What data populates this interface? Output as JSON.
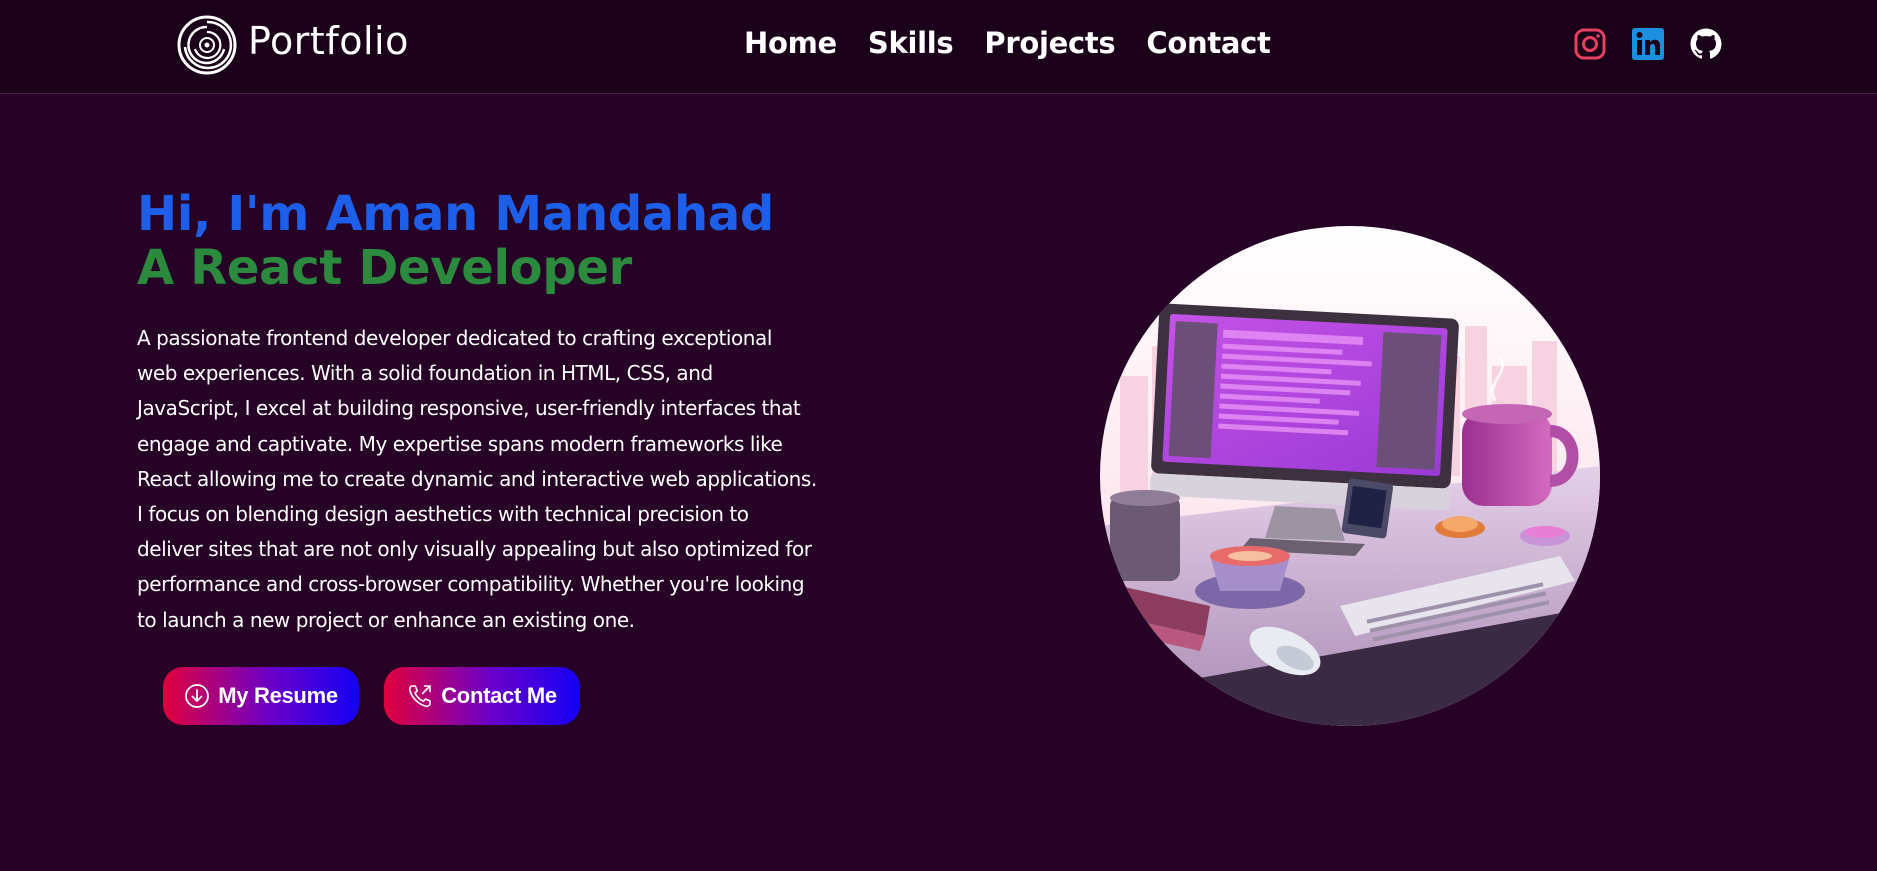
{
  "brand": {
    "name": "Portfolio",
    "logo_icon": "spiral-logo-icon"
  },
  "nav": {
    "links": [
      {
        "label": "Home"
      },
      {
        "label": "Skills"
      },
      {
        "label": "Projects"
      },
      {
        "label": "Contact"
      }
    ]
  },
  "socials": [
    {
      "icon": "instagram-icon",
      "color": "#e4405f"
    },
    {
      "icon": "linkedin-icon",
      "color": "#0a66c2"
    },
    {
      "icon": "github-icon",
      "color": "#ffffff"
    }
  ],
  "hero": {
    "greeting": "Hi, I'm Aman Mandahad",
    "role": "A React Developer",
    "description": "A passionate frontend developer dedicated to crafting exceptional web experiences. With a solid foundation in HTML, CSS, and JavaScript, I excel at building responsive, user-friendly interfaces that engage and captivate. My expertise spans modern frameworks like React allowing me to create dynamic and interactive web applications. I focus on blending design aesthetics with technical precision to deliver sites that are not only visually appealing but also optimized for performance and cross-browser compatibility. Whether you're looking to launch a new project or enhance an existing one.",
    "buttons": {
      "resume_label": "My Resume",
      "resume_icon": "download-circle-icon",
      "contact_label": "Contact Me",
      "contact_icon": "phone-outgoing-icon"
    }
  },
  "illustration": {
    "subject": "desk-workspace-illustration"
  },
  "colors": {
    "background": "#250226",
    "navbar": "#1a0119",
    "greeting": "#1d5fe8",
    "role": "#2b8a3e",
    "button_gradient_start": "#e0003c",
    "button_gradient_end": "#1400f5"
  }
}
